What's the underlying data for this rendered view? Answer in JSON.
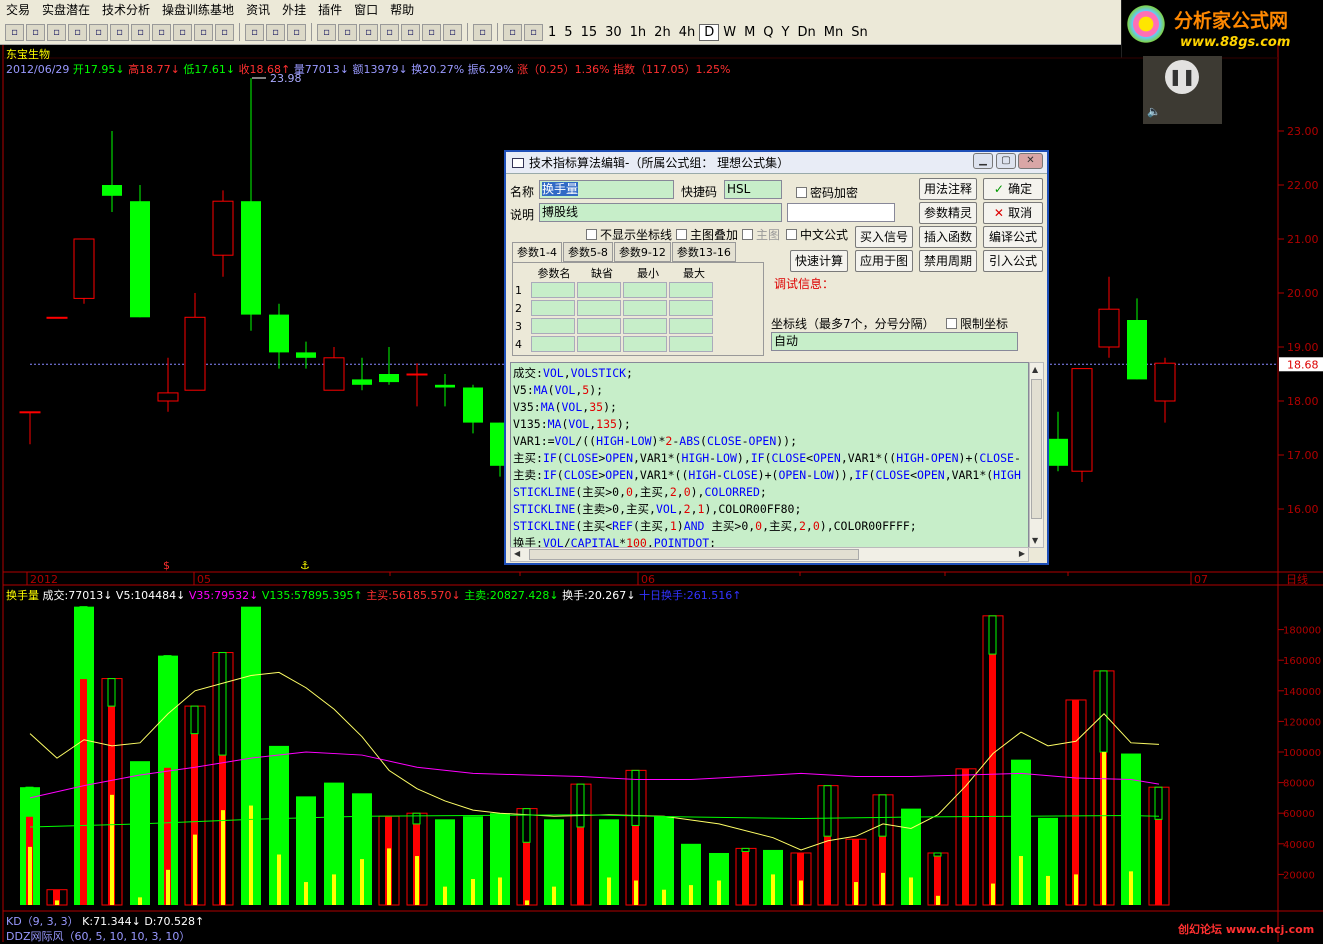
{
  "menu": [
    "交易",
    "实盘潜在",
    "技术分析",
    "操盘训练基地",
    "资讯",
    "外挂",
    "插件",
    "窗口",
    "帮助"
  ],
  "toolbar": {
    "periods": [
      "1",
      "5",
      "15",
      "30",
      "1h",
      "2h",
      "4h",
      "D",
      "W",
      "M",
      "Q",
      "Y",
      "Dn",
      "Mn",
      "Sn"
    ],
    "selected": "D"
  },
  "logo": {
    "title": "分析家公式网",
    "url": "www.88gs.com"
  },
  "stock": {
    "name": "东宝生物",
    "date": "2012/06/29",
    "open": "开17.95",
    "high": "高18.77",
    "low": "低17.61",
    "close": "收18.68",
    "vol": "量77013",
    "amount": "额13979",
    "turnover": "换20.27%",
    "amplitude": "振6.29%",
    "change": "涨（0.25）1.36%",
    "index": "指数（117.05）1.25%",
    "peak": "23.98",
    "price_tag": "18.68"
  },
  "price_axis": [
    "23.00",
    "22.00",
    "21.00",
    "20.00",
    "19.00",
    "18.00",
    "17.00",
    "16.00"
  ],
  "date_axis": {
    "year": "2012",
    "m5": "05",
    "m6": "06",
    "m7": "07",
    "mode": "日线"
  },
  "vol_axis": [
    "180000",
    "160000",
    "140000",
    "120000",
    "100000",
    "80000",
    "60000",
    "40000",
    "20000"
  ],
  "indicator": {
    "name": "换手量",
    "vol": "成交:77013",
    "v5": "V5:104484",
    "v35": "V35:79532",
    "v135": "V135:57895.395",
    "buy": "主买:56185.570",
    "sell": "主卖:20827.428",
    "turn": "换手:20.267",
    "turn10": "十日换手:261.516"
  },
  "bottom": {
    "kd": "KD（9, 3, 3）",
    "k": "K:71.344",
    "d": "D:70.528",
    "ddz": "DDZ网际风（60, 5, 10, 10, 3, 10）",
    "watermark": "创幻论坛 www.chcj.com"
  },
  "colors": {
    "up": "#ff0000",
    "down": "#00ff00",
    "yellow": "#ffff00",
    "magenta": "#ff00ff",
    "axis": "#b00000"
  },
  "dialog": {
    "title": "技术指标算法编辑-（所属公式组：    理想公式集）",
    "name_label": "名称",
    "name_value": "换手量",
    "shortcut_label": "快捷码",
    "shortcut_value": "HSL",
    "password_label": "密码加密",
    "desc_label": "说明",
    "desc_value": "搏股线",
    "hide_axis": "不显示坐标线",
    "main_overlay": "主图叠加",
    "main_chart": "主图",
    "chinese": "中文公式",
    "tabs": [
      "参数1-4",
      "参数5-8",
      "参数9-12",
      "参数13-16"
    ],
    "param_headers": [
      "参数名",
      "缺省",
      "最小",
      "最大"
    ],
    "param_rows": [
      "1",
      "2",
      "3",
      "4"
    ],
    "debug_label": "调试信息：",
    "axis_label": "坐标线（最多7个，分号分隔）",
    "limit_axis": "限制坐标",
    "axis_value": "自动",
    "buttons": {
      "usage": "用法注释",
      "ok": "确定",
      "wizard": "参数精灵",
      "cancel": "取消",
      "buy": "买入信号",
      "insert": "插入函数",
      "compile": "编译公式",
      "quick": "快速计算",
      "apply": "应用于图",
      "ban": "禁用周期",
      "import": "引入公式"
    },
    "code": [
      "成交:VOL,VOLSTICK;",
      "V5:MA(VOL,5);",
      "V35:MA(VOL,35);",
      "V135:MA(VOL,135);",
      "VAR1:=VOL/((HIGH-LOW)*2-ABS(CLOSE-OPEN));",
      "主买:IF(CLOSE>OPEN,VAR1*(HIGH-LOW),IF(CLOSE<OPEN,VAR1*((HIGH-OPEN)+(CLOSE-",
      "主卖:IF(CLOSE>OPEN,VAR1*((HIGH-CLOSE)+(OPEN-LOW)),IF(CLOSE<OPEN,VAR1*(HIGH",
      "STICKLINE(主买>0,0,主买,2,0),COLORRED;",
      "STICKLINE(主卖>0,主买,VOL,2,1),COLOR00FF80;",
      "STICKLINE(主买<REF(主买,1)AND 主买>0,0,主买,2,0),COLOR00FFFF;",
      "换手:VOL/CAPITAL*100,POINTDOT;"
    ]
  }
}
